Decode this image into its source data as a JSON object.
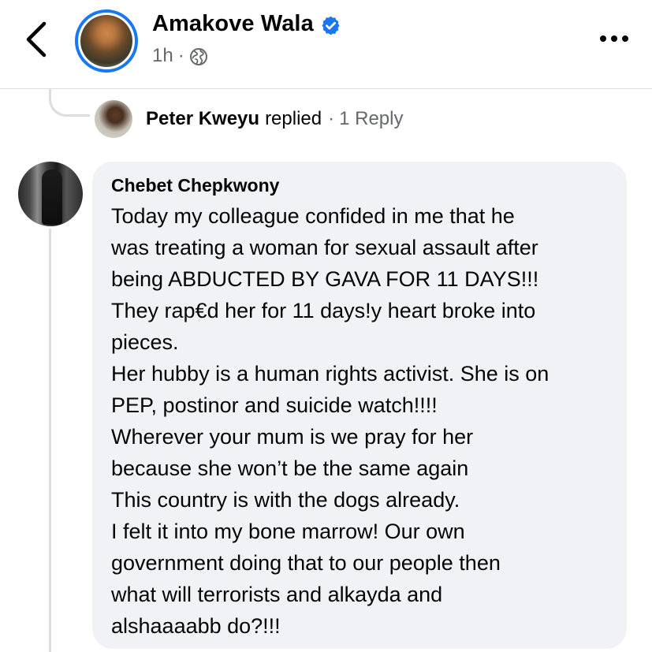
{
  "header": {
    "author_name": "Amakove Wala",
    "time": "1h",
    "separator": "·",
    "verified": true,
    "privacy_icon": "globe-icon",
    "more_icon": "more-horizontal-icon",
    "back_icon": "chevron-left-icon"
  },
  "reply_summary": {
    "name": "Peter Kweyu",
    "action": "replied",
    "separator": "·",
    "count_label": "1 Reply"
  },
  "comment": {
    "author": "Chebet Chepkwony",
    "lines": [
      "Today my colleague confided in me that he",
      "was treating a woman for sexual assault after",
      "being ABDUCTED BY GAVA FOR 11 DAYS!!!",
      "They rap€d her for 11 days!y heart broke into",
      "pieces.",
      "Her hubby is a human rights activist. She is on",
      "PEP, postinor and suicide watch!!!!",
      "Wherever your mum is we pray for her",
      "because she won’t be the same again",
      "This country is with the dogs already.",
      "I felt it into my bone marrow! Our own",
      "government doing that to our people then",
      "what will terrorists and alkayda and",
      "alshaaaabb do?!!!"
    ]
  },
  "colors": {
    "accent": "#1877f2",
    "secondary_text": "#65676b",
    "bubble": "#f0f2f5",
    "divider": "#dadde1"
  }
}
